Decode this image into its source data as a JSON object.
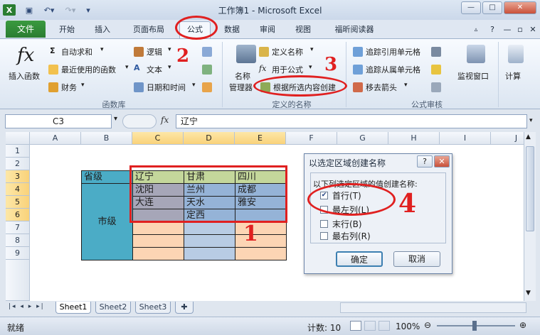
{
  "window": {
    "title": "工作簿1 - Microsoft Excel"
  },
  "tabs": {
    "file": "文件",
    "items": [
      "开始",
      "插入",
      "页面布局",
      "公式",
      "数据",
      "审阅",
      "视图",
      "福昕阅读器"
    ]
  },
  "ribbon": {
    "insert_function": "插入函数",
    "autosum": "自动求和",
    "recent": "最近使用的函数",
    "financial": "财务",
    "logical": "逻辑",
    "text": "文本",
    "datetime": "日期和时间",
    "group_library": "函数库",
    "name_manager_1": "名称",
    "name_manager_2": "管理器",
    "define_name": "定义名称",
    "use_in_formula": "用于公式",
    "create_from_selection": "根据所选内容创建",
    "group_names": "定义的名称",
    "trace_precedents": "追踪引用单元格",
    "trace_dependents": "追踪从属单元格",
    "remove_arrows": "移去箭头",
    "watch_window": "监视窗口",
    "calculation": "计算",
    "group_audit": "公式审核"
  },
  "formula_bar": {
    "name_box": "C3",
    "fx": "fx",
    "value": "辽宁"
  },
  "grid": {
    "columns": [
      "A",
      "B",
      "C",
      "D",
      "E",
      "F",
      "G",
      "H",
      "I",
      "J"
    ],
    "rows": [
      "1",
      "2",
      "3",
      "4",
      "5",
      "6",
      "7",
      "8",
      "9"
    ],
    "province_label": "省级",
    "city_label": "市级",
    "c3": "辽宁",
    "d3": "甘肃",
    "e3": "四川",
    "c4": "沈阳",
    "d4": "兰州",
    "e4": "成都",
    "c5": "大连",
    "d5": "天水",
    "e5": "雅安",
    "d6": "定西"
  },
  "sheets": [
    "Sheet1",
    "Sheet2",
    "Sheet3"
  ],
  "status": {
    "ready": "就绪",
    "count": "计数: 10",
    "zoom": "100%"
  },
  "dialog": {
    "title": "以选定区域创建名称",
    "help": "?",
    "prompt": "以下列选定区域的值创建名称:",
    "options": [
      "首行(T)",
      "最左列(L)",
      "末行(B)",
      "最右列(R)"
    ],
    "ok": "确定",
    "cancel": "取消"
  },
  "annotations": [
    "1",
    "2",
    "3",
    "4"
  ],
  "colors": {
    "accent_green": "#2a7d32",
    "highlight_red": "#e02020",
    "province_fill": "#c4d79b",
    "city_fill": "#4bacc6",
    "selected_cells": "#a6a6b8",
    "blue_col": "#95b3d7",
    "orange_cells": "#fcd5b4"
  }
}
